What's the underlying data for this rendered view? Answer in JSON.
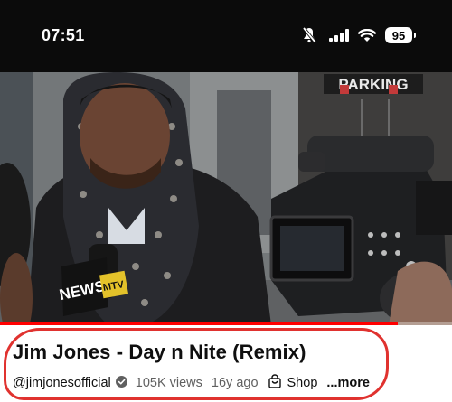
{
  "status_bar": {
    "time": "07:51",
    "battery": "95",
    "icons": [
      "mute-icon",
      "signal-icon",
      "wifi-icon",
      "battery-icon"
    ]
  },
  "video": {
    "sign_text": "PARKING",
    "mic_flag_text": "NEWS",
    "mic_logo_text": "MTV",
    "progress": 0.88
  },
  "info": {
    "title": "Jim Jones - Day n Nite (Remix)",
    "channel": "@jimjonesofficial",
    "views": "105K views",
    "age": "16y ago",
    "shop_label": "Shop",
    "more_label": "...more"
  },
  "colors": {
    "accent_red": "#ff0000",
    "annotation_red": "#e0322f",
    "verified_grey": "#606060"
  }
}
